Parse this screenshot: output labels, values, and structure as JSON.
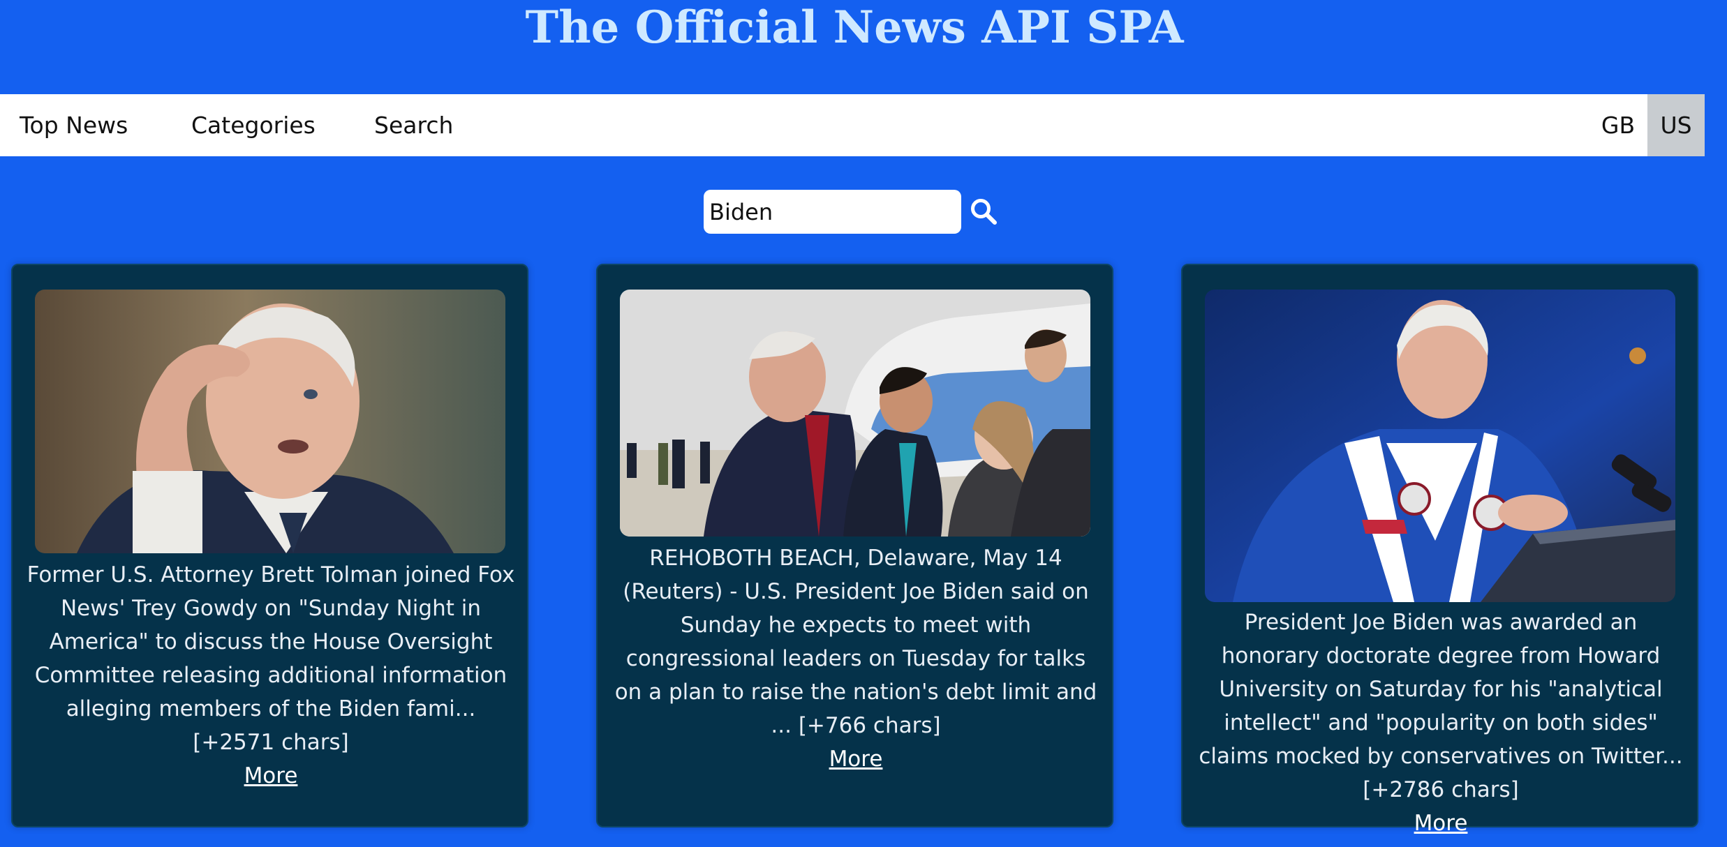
{
  "header": {
    "title": "The Official News API SPA"
  },
  "nav": {
    "items": [
      {
        "label": "Top News"
      },
      {
        "label": "Categories"
      },
      {
        "label": "Search"
      }
    ],
    "countries": [
      {
        "label": "GB",
        "active": false
      },
      {
        "label": "US",
        "active": true
      }
    ]
  },
  "search": {
    "value": "Biden",
    "icon": "magnifier"
  },
  "articles": [
    {
      "description": "Former U.S. Attorney Brett Tolman joined Fox News' Trey Gowdy on \"Sunday Night in America\" to discuss the House Oversight Committee releasing additional information alleging members of the Biden fami... [+2571 chars]",
      "more_label": "More",
      "image": "Man with hand on forehead, speaking"
    },
    {
      "description": "REHOBOTH BEACH, Delaware, May 14 (Reuters) - U.S. President Joe Biden said on Sunday he expects to meet with congressional leaders on Tuesday for talks on a plan to raise the nation's debt limit and ... [+766 chars]",
      "more_label": "More",
      "image": "President speaking with reporters in front of an airplane"
    },
    {
      "description": "President Joe Biden was awarded an honorary doctorate degree from Howard University on Saturday for his \"analytical intellect\" and \"popularity on both sides\" claims mocked by conservatives on Twitter... [+2786 chars]",
      "more_label": "More",
      "image": "President in academic robe speaking at a podium"
    }
  ],
  "colors": {
    "page_background": "#1460f0",
    "title": "#cfe9ff",
    "card_background": "#05324a",
    "active_country": "#c8ccd0"
  }
}
